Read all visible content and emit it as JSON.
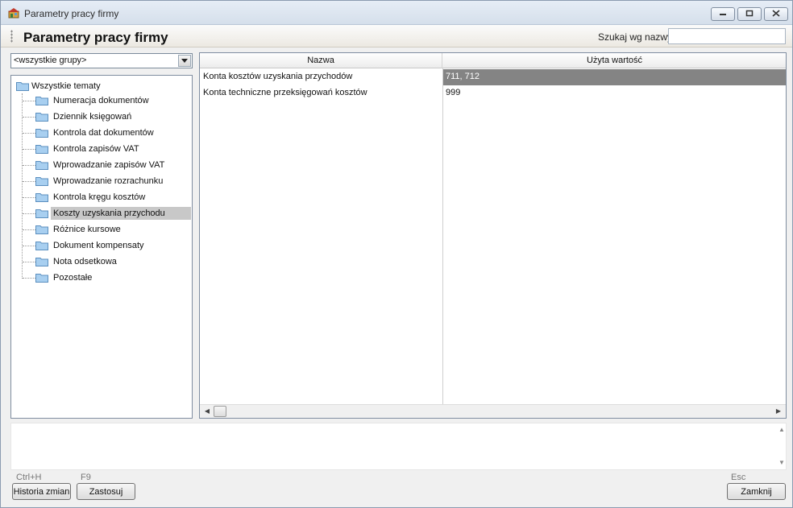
{
  "window": {
    "title": "Parametry pracy firmy",
    "minimize_icon": "minimize-icon",
    "maximize_icon": "restore-icon",
    "close_icon": "close-icon"
  },
  "header": {
    "title": "Parametry pracy firmy",
    "search_label": "Szukaj wg nazwy",
    "search_value": ""
  },
  "group_select": {
    "value": "<wszystkie grupy>"
  },
  "tree": {
    "root": "Wszystkie tematy",
    "items": [
      "Numeracja dokumentów",
      "Dziennik księgowań",
      "Kontrola dat dokumentów",
      "Kontrola zapisów VAT",
      "Wprowadzanie zapisów VAT",
      "Wprowadzanie rozrachunku",
      "Kontrola kręgu kosztów",
      "Koszty uzyskania przychodu",
      "Różnice kursowe",
      "Dokument kompensaty",
      "Nota odsetkowa",
      "Pozostałe"
    ],
    "selected": "Koszty uzyskania przychodu"
  },
  "grid": {
    "columns": [
      "Nazwa",
      "Użyta wartość"
    ],
    "rows": [
      [
        "Konta kosztów uzyskania przychodów",
        "711, 712"
      ],
      [
        "Konta techniczne przeksięgowań kosztów",
        "999"
      ]
    ]
  },
  "footer": {
    "history_hint": "Ctrl+H",
    "history_label": "Historia zmian",
    "apply_hint": "F9",
    "apply_label": "Zastosuj",
    "close_hint": "Esc",
    "close_label": "Zamknij"
  },
  "colors": {
    "selected_cell_bg": "#848484",
    "selected_tree_bg": "#c8c8c8",
    "folder_icon": "#a8cff0"
  }
}
